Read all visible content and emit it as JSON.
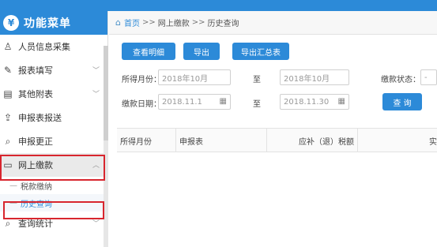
{
  "sidebar": {
    "title": "功能菜单",
    "logo_glyph": "¥",
    "items": [
      {
        "label": "人员信息采集",
        "icon": "person-icon",
        "glyph": "♙",
        "has_chevron": false
      },
      {
        "label": "报表填写",
        "icon": "edit-icon",
        "glyph": "✎",
        "has_chevron": true
      },
      {
        "label": "其他附表",
        "icon": "doc-icon",
        "glyph": "▤",
        "has_chevron": true
      },
      {
        "label": "申报表报送",
        "icon": "upload-icon",
        "glyph": "⇪",
        "has_chevron": false
      },
      {
        "label": "申报更正",
        "icon": "search-icon",
        "glyph": "⌕",
        "has_chevron": false
      },
      {
        "label": "网上缴款",
        "icon": "folder-icon",
        "glyph": "▭",
        "has_chevron": true
      }
    ],
    "sub_items": [
      {
        "label": "税款缴纳"
      },
      {
        "label": "历史查询"
      }
    ],
    "last_item": {
      "label": "查询统计",
      "icon": "query-icon",
      "glyph": "⌕"
    }
  },
  "breadcrumb": {
    "home": "首页",
    "sep": ">>",
    "level2": "网上缴款",
    "level3": "历史查询"
  },
  "toolbar": {
    "detail_label": "查看明细",
    "export_label": "导出",
    "export_summary_label": "导出汇总表"
  },
  "filters": {
    "income_month_label": "所得月份：",
    "income_month_from": "2018年10月",
    "to_label": "至",
    "income_month_to": "2018年10月",
    "payment_status_label": "缴款状态：",
    "payment_status_value": "-",
    "payment_date_label": "缴款日期：",
    "payment_date_from": "2018.11.1",
    "payment_date_to": "2018.11.30",
    "query_label": "查 询"
  },
  "table": {
    "headers": [
      "所得月份",
      "申报表",
      "应补（退）税额",
      "实"
    ]
  },
  "colors": {
    "accent": "#2c8ad8",
    "highlight": "#d8262e"
  }
}
